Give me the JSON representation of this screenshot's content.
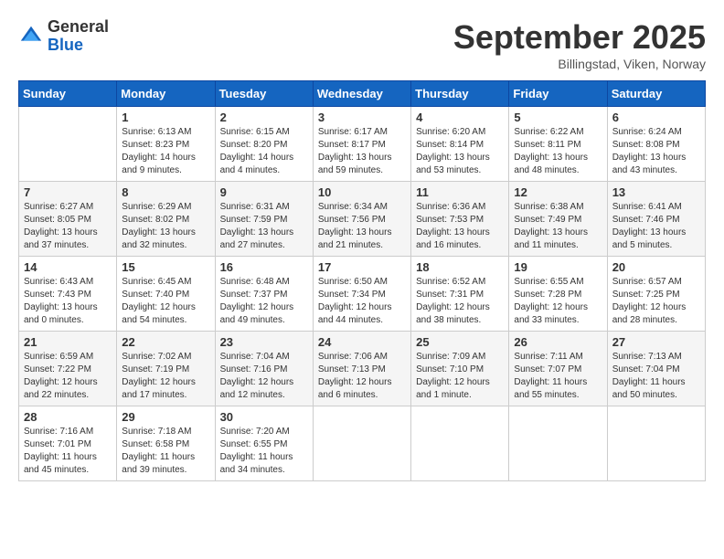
{
  "logo": {
    "general": "General",
    "blue": "Blue"
  },
  "title": "September 2025",
  "location": "Billingstad, Viken, Norway",
  "days_header": [
    "Sunday",
    "Monday",
    "Tuesday",
    "Wednesday",
    "Thursday",
    "Friday",
    "Saturday"
  ],
  "weeks": [
    [
      {
        "day": "",
        "detail": ""
      },
      {
        "day": "1",
        "detail": "Sunrise: 6:13 AM\nSunset: 8:23 PM\nDaylight: 14 hours\nand 9 minutes."
      },
      {
        "day": "2",
        "detail": "Sunrise: 6:15 AM\nSunset: 8:20 PM\nDaylight: 14 hours\nand 4 minutes."
      },
      {
        "day": "3",
        "detail": "Sunrise: 6:17 AM\nSunset: 8:17 PM\nDaylight: 13 hours\nand 59 minutes."
      },
      {
        "day": "4",
        "detail": "Sunrise: 6:20 AM\nSunset: 8:14 PM\nDaylight: 13 hours\nand 53 minutes."
      },
      {
        "day": "5",
        "detail": "Sunrise: 6:22 AM\nSunset: 8:11 PM\nDaylight: 13 hours\nand 48 minutes."
      },
      {
        "day": "6",
        "detail": "Sunrise: 6:24 AM\nSunset: 8:08 PM\nDaylight: 13 hours\nand 43 minutes."
      }
    ],
    [
      {
        "day": "7",
        "detail": "Sunrise: 6:27 AM\nSunset: 8:05 PM\nDaylight: 13 hours\nand 37 minutes."
      },
      {
        "day": "8",
        "detail": "Sunrise: 6:29 AM\nSunset: 8:02 PM\nDaylight: 13 hours\nand 32 minutes."
      },
      {
        "day": "9",
        "detail": "Sunrise: 6:31 AM\nSunset: 7:59 PM\nDaylight: 13 hours\nand 27 minutes."
      },
      {
        "day": "10",
        "detail": "Sunrise: 6:34 AM\nSunset: 7:56 PM\nDaylight: 13 hours\nand 21 minutes."
      },
      {
        "day": "11",
        "detail": "Sunrise: 6:36 AM\nSunset: 7:53 PM\nDaylight: 13 hours\nand 16 minutes."
      },
      {
        "day": "12",
        "detail": "Sunrise: 6:38 AM\nSunset: 7:49 PM\nDaylight: 13 hours\nand 11 minutes."
      },
      {
        "day": "13",
        "detail": "Sunrise: 6:41 AM\nSunset: 7:46 PM\nDaylight: 13 hours\nand 5 minutes."
      }
    ],
    [
      {
        "day": "14",
        "detail": "Sunrise: 6:43 AM\nSunset: 7:43 PM\nDaylight: 13 hours\nand 0 minutes."
      },
      {
        "day": "15",
        "detail": "Sunrise: 6:45 AM\nSunset: 7:40 PM\nDaylight: 12 hours\nand 54 minutes."
      },
      {
        "day": "16",
        "detail": "Sunrise: 6:48 AM\nSunset: 7:37 PM\nDaylight: 12 hours\nand 49 minutes."
      },
      {
        "day": "17",
        "detail": "Sunrise: 6:50 AM\nSunset: 7:34 PM\nDaylight: 12 hours\nand 44 minutes."
      },
      {
        "day": "18",
        "detail": "Sunrise: 6:52 AM\nSunset: 7:31 PM\nDaylight: 12 hours\nand 38 minutes."
      },
      {
        "day": "19",
        "detail": "Sunrise: 6:55 AM\nSunset: 7:28 PM\nDaylight: 12 hours\nand 33 minutes."
      },
      {
        "day": "20",
        "detail": "Sunrise: 6:57 AM\nSunset: 7:25 PM\nDaylight: 12 hours\nand 28 minutes."
      }
    ],
    [
      {
        "day": "21",
        "detail": "Sunrise: 6:59 AM\nSunset: 7:22 PM\nDaylight: 12 hours\nand 22 minutes."
      },
      {
        "day": "22",
        "detail": "Sunrise: 7:02 AM\nSunset: 7:19 PM\nDaylight: 12 hours\nand 17 minutes."
      },
      {
        "day": "23",
        "detail": "Sunrise: 7:04 AM\nSunset: 7:16 PM\nDaylight: 12 hours\nand 12 minutes."
      },
      {
        "day": "24",
        "detail": "Sunrise: 7:06 AM\nSunset: 7:13 PM\nDaylight: 12 hours\nand 6 minutes."
      },
      {
        "day": "25",
        "detail": "Sunrise: 7:09 AM\nSunset: 7:10 PM\nDaylight: 12 hours\nand 1 minute."
      },
      {
        "day": "26",
        "detail": "Sunrise: 7:11 AM\nSunset: 7:07 PM\nDaylight: 11 hours\nand 55 minutes."
      },
      {
        "day": "27",
        "detail": "Sunrise: 7:13 AM\nSunset: 7:04 PM\nDaylight: 11 hours\nand 50 minutes."
      }
    ],
    [
      {
        "day": "28",
        "detail": "Sunrise: 7:16 AM\nSunset: 7:01 PM\nDaylight: 11 hours\nand 45 minutes."
      },
      {
        "day": "29",
        "detail": "Sunrise: 7:18 AM\nSunset: 6:58 PM\nDaylight: 11 hours\nand 39 minutes."
      },
      {
        "day": "30",
        "detail": "Sunrise: 7:20 AM\nSunset: 6:55 PM\nDaylight: 11 hours\nand 34 minutes."
      },
      {
        "day": "",
        "detail": ""
      },
      {
        "day": "",
        "detail": ""
      },
      {
        "day": "",
        "detail": ""
      },
      {
        "day": "",
        "detail": ""
      }
    ]
  ]
}
